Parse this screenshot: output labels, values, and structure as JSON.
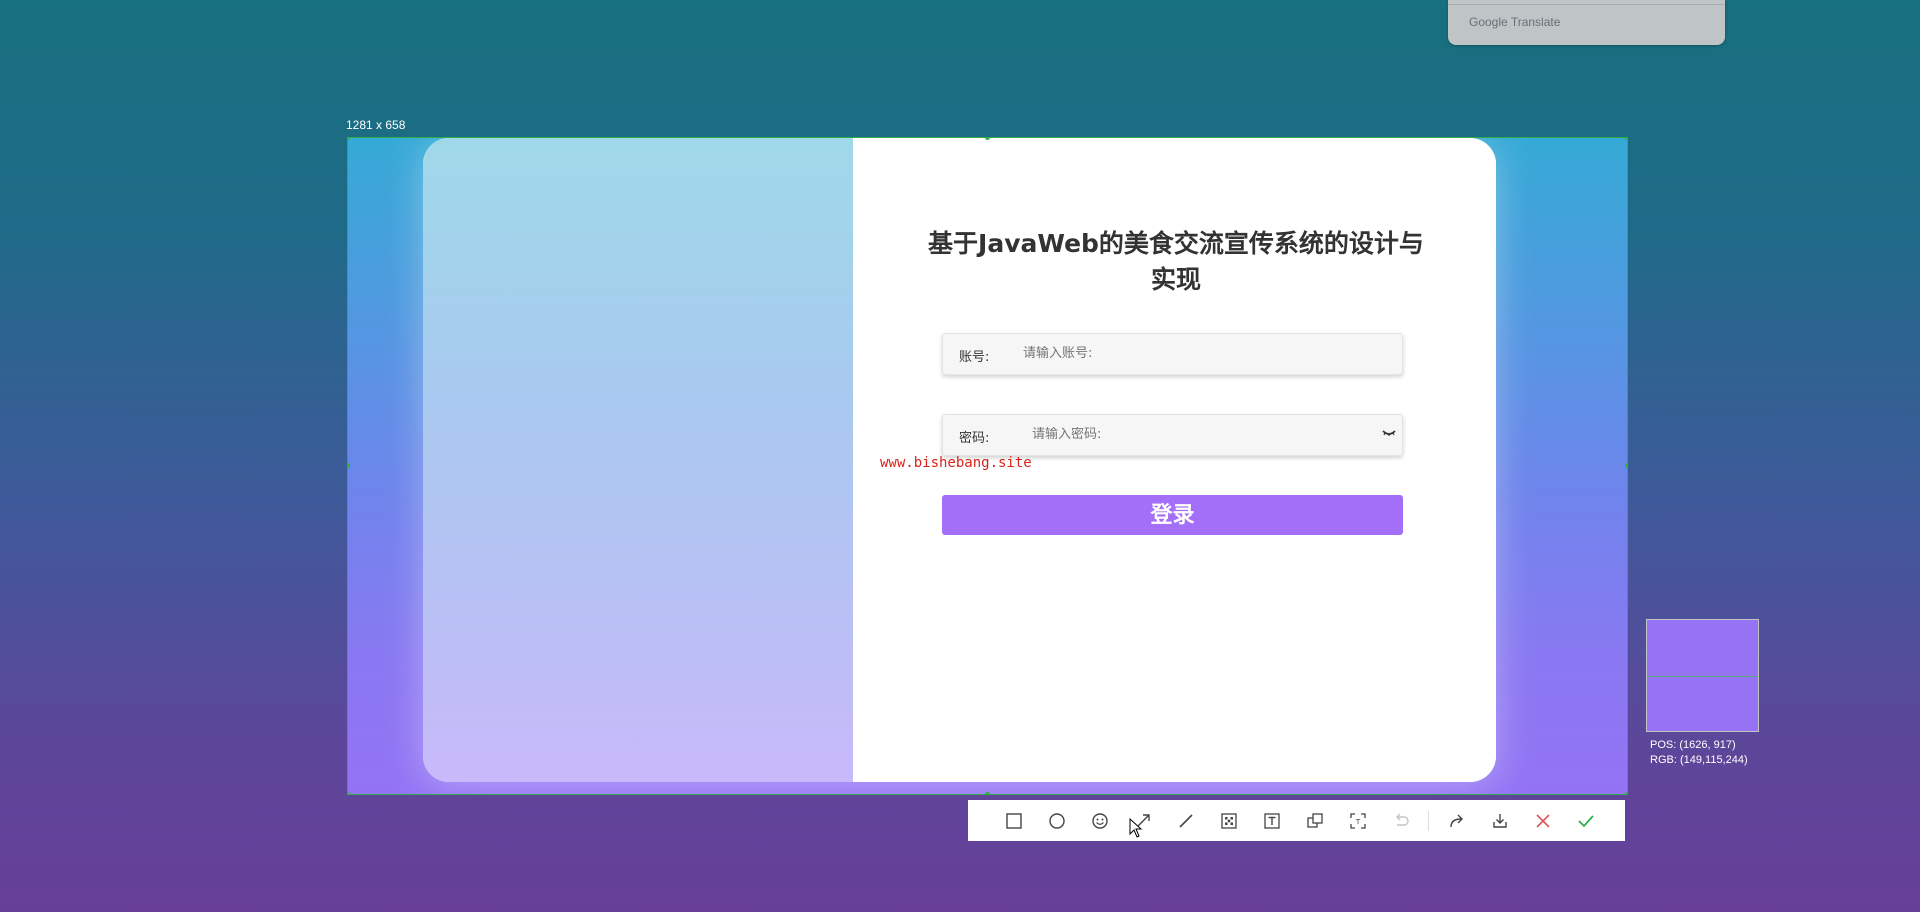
{
  "translate_bar": {
    "label": "Google Translate"
  },
  "selection": {
    "size_label": "1281 x 658"
  },
  "login": {
    "title": "基于JavaWeb的美食交流宣传系统的设计与实现",
    "account_label": "账号:",
    "account_placeholder": "请输入账号:",
    "password_label": "密码:",
    "password_placeholder": "请输入密码:",
    "login_button": "登录"
  },
  "watermark": "www.bishebang.site",
  "toolbar": {
    "tools": [
      "rectangle-icon",
      "ellipse-icon",
      "emoji-icon",
      "arrow-icon",
      "line-icon",
      "mosaic-icon",
      "text-icon",
      "pin-icon",
      "ocr-icon",
      "undo-icon",
      "share-icon",
      "save-icon",
      "cancel-icon",
      "confirm-icon"
    ]
  },
  "magnifier": {
    "pos_text": "POS:  (1626, 917)",
    "rgb_text": "RGB:  (149,115,244)"
  },
  "colors": {
    "accent": "#a36ef8",
    "selection_border": "#2fae4a",
    "watermark": "#d9241c"
  }
}
